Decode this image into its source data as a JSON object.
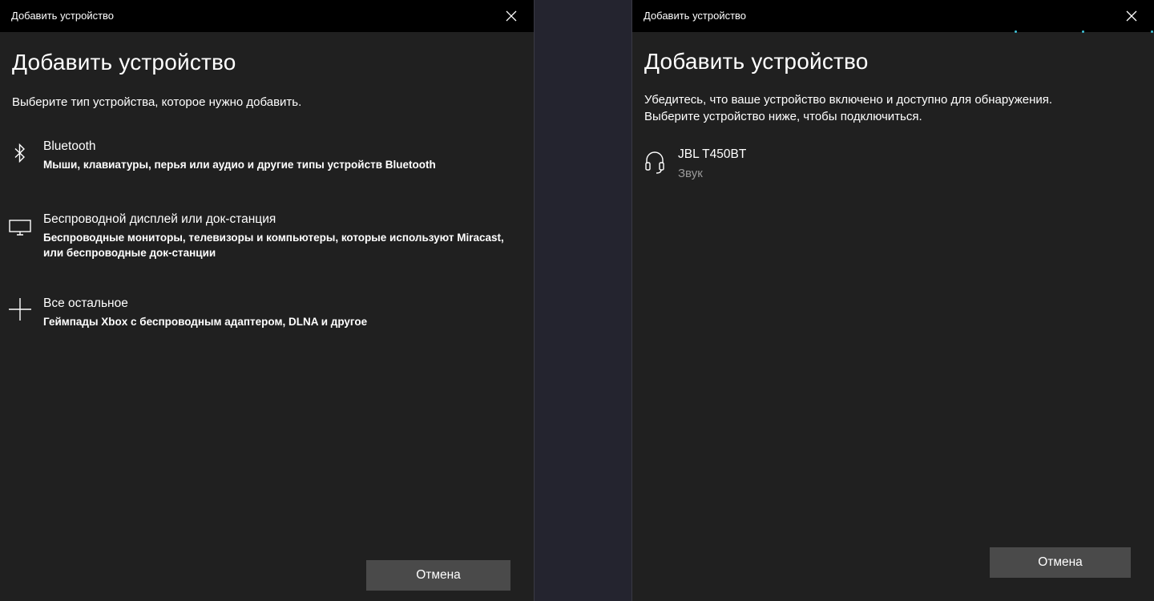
{
  "left_window": {
    "title": "Добавить устройство",
    "heading": "Добавить устройство",
    "subtitle": "Выберите тип устройства, которое нужно добавить.",
    "options": [
      {
        "icon": "bluetooth-icon",
        "title": "Bluetooth",
        "description": "Мыши, клавиатуры, перья или аудио и другие типы устройств Bluetooth"
      },
      {
        "icon": "monitor-icon",
        "title": "Беспроводной дисплей или док-станция",
        "description": "Беспроводные мониторы, телевизоры и компьютеры, которые используют Miracast,\nили беспроводные док-станции"
      },
      {
        "icon": "plus-icon",
        "title": "Все остальное",
        "description": "Геймпады Xbox с беспроводным адаптером, DLNA и другое"
      }
    ],
    "cancel_label": "Отмена"
  },
  "right_window": {
    "title": "Добавить устройство",
    "heading": "Добавить устройство",
    "instructions_line1": "Убедитесь, что ваше устройство включено и доступно для обнаружения.",
    "instructions_line2": "Выберите устройство ниже, чтобы подключиться.",
    "device": {
      "icon": "headphones-icon",
      "name": "JBL T450BT",
      "type": "Звук"
    },
    "cancel_label": "Отмена"
  },
  "colors": {
    "window_bg": "#202020",
    "titlebar_bg": "#000000",
    "desktop_bg": "#24242f",
    "button_bg": "#4a4a4a",
    "secondary_text": "#9a9a9a",
    "accent_dots": "#3fc1d6"
  }
}
